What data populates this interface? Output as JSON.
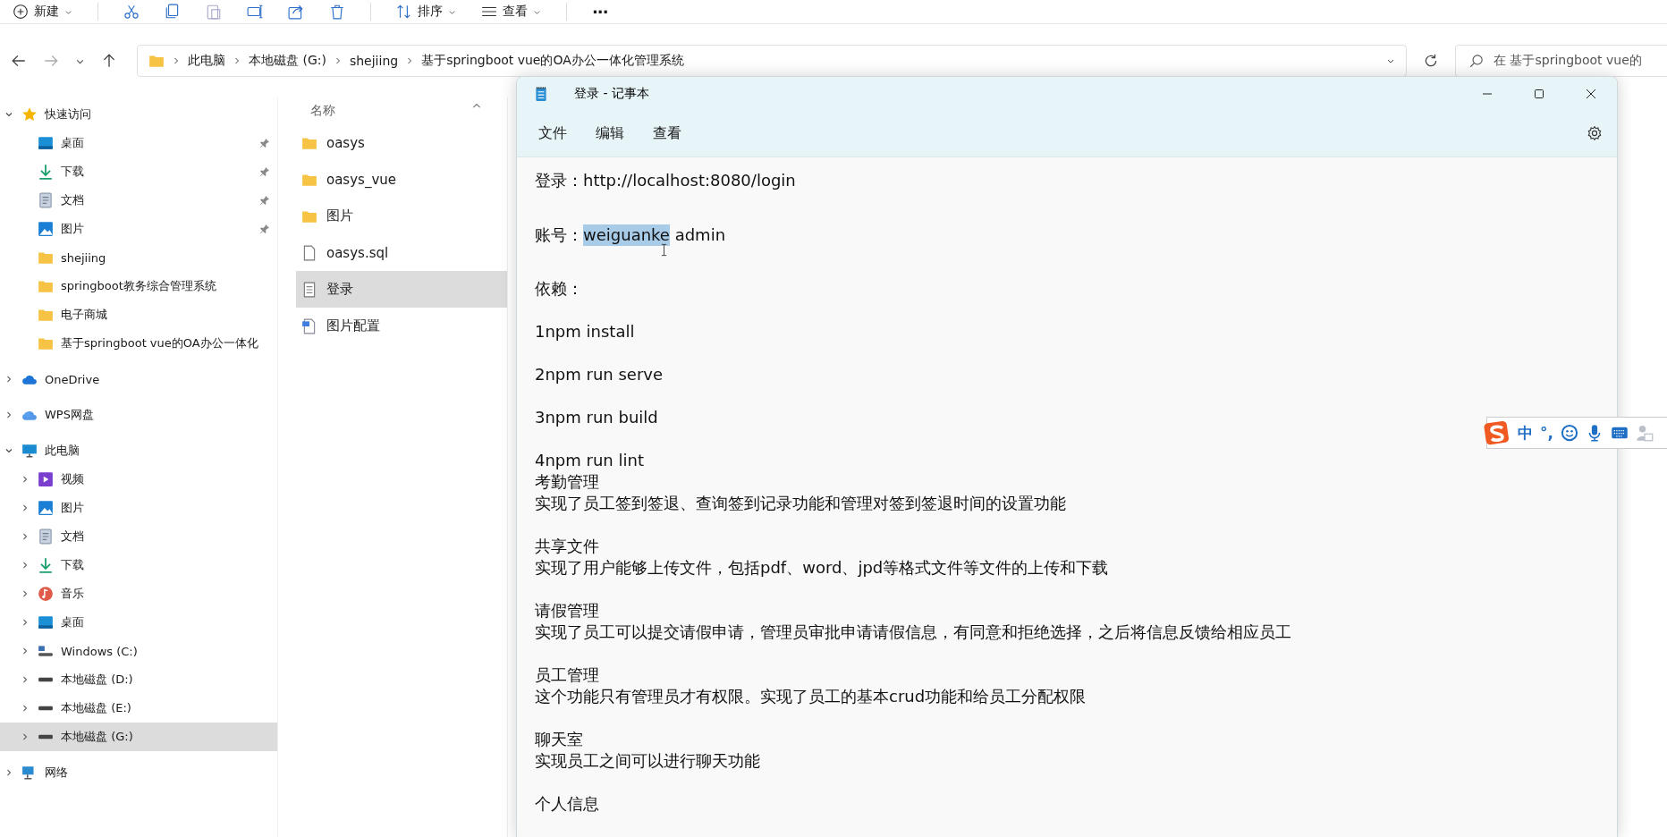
{
  "toolbar": {
    "new_label": "新建",
    "sort_label": "排序",
    "view_label": "查看",
    "more_label": "···"
  },
  "address_bar": {
    "crumbs": [
      "此电脑",
      "本地磁盘 (G:)",
      "shejiing",
      "基于springboot vue的OA办公一体化管理系统"
    ],
    "search_placeholder": "在 基于springboot vue的"
  },
  "nav_tree": [
    {
      "label": "快速访问",
      "kind": "star",
      "expanded": true,
      "selected": false,
      "children": [
        {
          "label": "桌面",
          "kind": "desktop",
          "pinned": true,
          "selected": false
        },
        {
          "label": "下载",
          "kind": "download",
          "pinned": true,
          "selected": false
        },
        {
          "label": "文档",
          "kind": "document",
          "pinned": true,
          "selected": false
        },
        {
          "label": "图片",
          "kind": "pictures",
          "pinned": true,
          "selected": false
        },
        {
          "label": "shejiing",
          "kind": "folder",
          "pinned": false,
          "selected": false
        },
        {
          "label": "springboot教务综合管理系统",
          "kind": "folder",
          "pinned": false,
          "selected": false
        },
        {
          "label": "电子商城",
          "kind": "folder",
          "pinned": false,
          "selected": false
        },
        {
          "label": "基于springboot vue的OA办公一体化",
          "kind": "folder",
          "pinned": false,
          "selected": false
        }
      ]
    },
    {
      "label": "OneDrive",
      "kind": "cloud",
      "expanded": false,
      "selected": false
    },
    {
      "label": "WPS网盘",
      "kind": "wps-cloud",
      "expanded": false,
      "selected": false
    },
    {
      "label": "此电脑",
      "kind": "computer",
      "expanded": true,
      "selected": false,
      "children": [
        {
          "label": "视频",
          "kind": "video",
          "expanded": false,
          "selected": false
        },
        {
          "label": "图片",
          "kind": "pictures",
          "expanded": false,
          "selected": false
        },
        {
          "label": "文档",
          "kind": "document",
          "expanded": false,
          "selected": false
        },
        {
          "label": "下载",
          "kind": "download",
          "expanded": false,
          "selected": false
        },
        {
          "label": "音乐",
          "kind": "music",
          "expanded": false,
          "selected": false
        },
        {
          "label": "桌面",
          "kind": "desktop",
          "expanded": false,
          "selected": false
        },
        {
          "label": "Windows (C:)",
          "kind": "system-drive",
          "expanded": false,
          "selected": false
        },
        {
          "label": "本地磁盘 (D:)",
          "kind": "drive",
          "expanded": false,
          "selected": false
        },
        {
          "label": "本地磁盘 (E:)",
          "kind": "drive",
          "expanded": false,
          "selected": false
        },
        {
          "label": "本地磁盘 (G:)",
          "kind": "drive",
          "expanded": false,
          "selected": true
        }
      ]
    },
    {
      "label": "网络",
      "kind": "network",
      "expanded": false,
      "selected": false
    }
  ],
  "file_list": {
    "column": "名称",
    "files": [
      {
        "name": "oasys",
        "kind": "folder",
        "selected": false
      },
      {
        "name": "oasys_vue",
        "kind": "folder",
        "selected": false
      },
      {
        "name": "图片",
        "kind": "folder",
        "selected": false
      },
      {
        "name": "oasys.sql",
        "kind": "file",
        "selected": false
      },
      {
        "name": "登录",
        "kind": "text",
        "selected": true
      },
      {
        "name": "图片配置",
        "kind": "doc",
        "selected": false
      }
    ]
  },
  "notepad": {
    "title": "登录 - 记事本",
    "menus": [
      "文件",
      "编辑",
      "查看"
    ],
    "blocks": [
      [
        "登录：http://localhost:8080/login"
      ],
      [
        {
          "segments": [
            {
              "text": "账号：",
              "selected": false
            },
            {
              "text": "weiguanke",
              "selected": true
            },
            {
              "text": " admin",
              "selected": false
            }
          ]
        }
      ],
      [
        "依赖："
      ],
      [
        "1npm install"
      ],
      [
        "2npm run serve"
      ],
      [
        "3npm run build"
      ],
      [
        "4npm run lint",
        "考勤管理",
        "实现了员工签到签退、查询签到记录功能和管理对签到签退时间的设置功能"
      ],
      [
        "共享文件",
        "实现了用户能够上传文件，包括pdf、word、jpd等格式文件等文件的上传和下载"
      ],
      [
        "请假管理",
        "实现了员工可以提交请假申请，管理员审批申请请假信息，有同意和拒绝选择，之后将信息反馈给相应员工"
      ],
      [
        "员工管理",
        "这个功能只有管理员才有权限。实现了员工的基本crud功能和给员工分配权限"
      ],
      [
        "聊天室",
        "实现员工之间可以进行聊天功能"
      ],
      [
        "个人信息"
      ]
    ]
  },
  "ime_bar": {
    "mode": "中",
    "punct": "°,"
  }
}
